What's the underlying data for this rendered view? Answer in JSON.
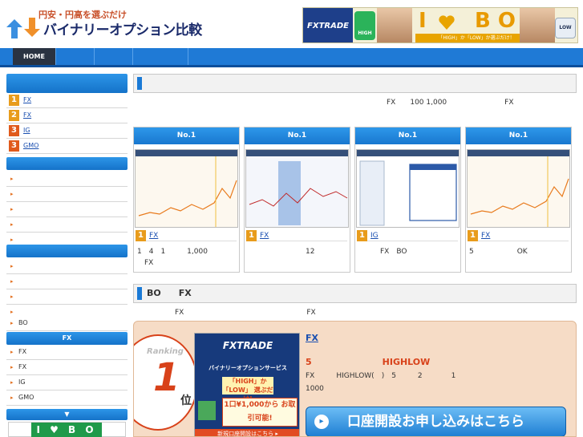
{
  "header": {
    "tagline": "円安・円高を選ぶだけ",
    "title": "バイナリーオプション比較",
    "banner": {
      "brand": "FXTRADE",
      "high_label": "HIGH",
      "i_text": "I",
      "bo_text": "B O",
      "caption": "「HIGH」か「LOW」か選ぶだけ！",
      "low_label": "LOW"
    }
  },
  "nav": {
    "home": "HOME"
  },
  "sidebar": {
    "ranking": [
      {
        "rank": "1",
        "name": "FX"
      },
      {
        "rank": "2",
        "name": "FX"
      },
      {
        "rank": "3",
        "name": "IG"
      },
      {
        "rank": "3",
        "name": "GMO"
      }
    ],
    "bo_header": "FX",
    "bo_items": [
      "FX",
      "FX",
      "IG",
      "GMO"
    ],
    "misc_item": "BO",
    "banner_arrow": "▼",
    "banner_text": "I ♥ B O"
  },
  "main": {
    "intro_line": "FX　　100 1,000　　　　　　　　FX",
    "cards": [
      {
        "title": "No.1",
        "rank": "1",
        "name": "FX",
        "desc": "1　4　1　　　1,000\n　FX"
      },
      {
        "title": "No.1",
        "rank": "1",
        "name": "FX",
        "desc": "　　　　　　　　12"
      },
      {
        "title": "No.1",
        "rank": "1",
        "name": "IG",
        "desc": "　　　FX　BO"
      },
      {
        "title": "No.1",
        "rank": "1",
        "name": "FX",
        "desc": "5　　　　　　OK"
      }
    ],
    "section2_title": "BO　　FX",
    "section2_intro": "FX　　　　　　　　　　　　　　　　　FX",
    "ranking_box": {
      "label": "Ranking",
      "number": "1",
      "unit": "位",
      "ad": {
        "brand": "FXTRADE",
        "service": "バイナリーオプションサービス",
        "highlow": "「HIGH」か「LOW」\n選ぶだけ!",
        "cta": "1口¥1,000から\nお取引可能!",
        "footer": "新規口座開設はこちら ▸"
      },
      "link": "FX",
      "highlight": "5　　　　　　　　HIGHLOW",
      "details": "FX　　　HIGHLOW(　)　5　　　2　　　　1\n1000",
      "button": "口座開設お申し込みはこちら"
    }
  }
}
